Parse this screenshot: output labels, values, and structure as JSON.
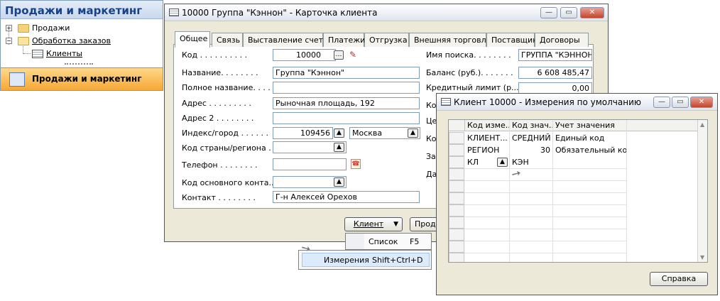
{
  "nav": {
    "title": "Продажи и маркетинг",
    "tree": [
      {
        "label": "Продажи"
      },
      {
        "label": "Обработка заказов"
      },
      {
        "label": "Клиенты"
      }
    ],
    "selected": "Продажи и маркетинг"
  },
  "card": {
    "title": "10000 Группа \"Кэннон\" - Карточка клиента",
    "tabs": [
      "Общее",
      "Связь",
      "Выставление счета",
      "Платежи",
      "Отгрузка",
      "Внешняя торговля",
      "Поставщик",
      "Договоры"
    ],
    "active_tab": "Общее",
    "fields": {
      "code_label": "Код . . . . . . . . . .",
      "code_value": "10000",
      "name_label": "Название. . . . . . . .",
      "name_value": "Группа \"Кэннон\"",
      "fullname_label": "Полное название. . . . .",
      "address_label": "Адрес . . . . . . . . .",
      "address_value": "Рыночная площадь, 192",
      "address2_label": "Адрес 2 . . . . . . . .",
      "postcode_label": "Индекс/город . . . . . .",
      "postcode_value": "109456",
      "city_value": "Москва",
      "country_label": "Код страны/региона . .",
      "phone_label": "Телефон . . . . . . . .",
      "primary_contact_label": "Код основного конта...",
      "contact_label": "Контакт . . . . . . . .",
      "contact_value": "Г-н Алексей Орехов",
      "search_label": "Имя поиска. . . . . . . .",
      "search_value": "ГРУППА \"КЭННОН\"",
      "balance_label": "Баланс (руб.). . . . . . .",
      "balance_value": "6 608 485,47",
      "credit_label": "Кредитный лимит (р...",
      "credit_value": "0,00",
      "partial_labels": [
        "Ко",
        "Це",
        "Ко",
        "За",
        "Да"
      ]
    },
    "buttons": {
      "client": "Клиент",
      "prod": "Прод"
    },
    "menu": [
      {
        "label": "Список",
        "shortcut": "F5"
      },
      {
        "label": "Измерения",
        "shortcut": "Shift+Ctrl+D"
      }
    ]
  },
  "dims": {
    "title": "Клиент 10000 - Измерения по умолчанию",
    "columns": [
      "Код изме...",
      "Код знач...",
      "Учет значения"
    ],
    "rows": [
      [
        "КЛИЕНТ...",
        "СРЕДНИЙ",
        "Единый код"
      ],
      [
        "РЕГИОН",
        "30",
        "Обязательный код"
      ],
      [
        "КЛ",
        "КЭН",
        ""
      ]
    ],
    "help_button": "Справка"
  }
}
